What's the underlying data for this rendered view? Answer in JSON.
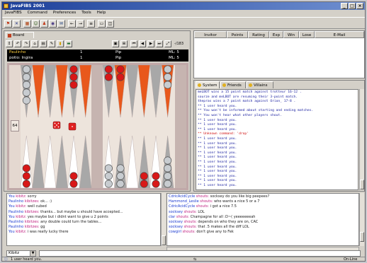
{
  "window": {
    "title": "JavaFIBS 2001"
  },
  "menu": [
    "JavaFIBS",
    "Command",
    "Preferences",
    "Tools",
    "Help"
  ],
  "board_panel": {
    "tab_label": "Board",
    "score": {
      "player1": {
        "name": "Paulinho",
        "value": "1",
        "pip_label": "Pip",
        "ml": "ML: 5"
      },
      "player2": {
        "name": "potio: Ingira",
        "value": "1",
        "pip_label": "Pip",
        "ml": "ML: 5"
      },
      "pip_count": "-/183"
    },
    "cube_value": "64",
    "colors": {
      "dark_point": "#a8a8a8",
      "light_point": "#ffffff",
      "accent_point": "#e8581c",
      "red_checker": "#d81818",
      "white_checker": "#c8ccd0"
    }
  },
  "player_table": {
    "columns": [
      "Invitor",
      "Points",
      "Rating",
      "Exp",
      "Win",
      "Lose",
      "E-Mail"
    ]
  },
  "message_panel": {
    "tabs": [
      "System",
      "Friends",
      "Villains"
    ],
    "lines": [
      {
        "text": "meLBOT wins a 15 point match against trotteur 16-12 .",
        "color": "blue"
      },
      {
        "text": "sourze and meLBOT are resuming their 3-point match.",
        "color": "blue"
      },
      {
        "text": "thepras wins a 7 point match against Orion_ 17-8 .",
        "color": "blue"
      },
      {
        "text": "** 1 user heard you.",
        "color": "blue"
      },
      {
        "text": "** You won't be informed about starting and ending matches.",
        "color": "blue"
      },
      {
        "text": "** You won't hear what other players shout.",
        "color": "blue"
      },
      {
        "text": "** 1 user heard you.",
        "color": "blue"
      },
      {
        "text": "** 1 user heard you.",
        "color": "blue"
      },
      {
        "text": "** 1 user heard you.",
        "color": "blue"
      },
      {
        "text": "** Unknown command: 'drop'",
        "color": "red"
      },
      {
        "text": "** 1 user heard you.",
        "color": "blue"
      },
      {
        "text": "** 1 user heard you.",
        "color": "blue"
      },
      {
        "text": "** 1 user heard you.",
        "color": "blue"
      },
      {
        "text": "** 1 user heard you.",
        "color": "blue"
      },
      {
        "text": "** 1 user heard you.",
        "color": "blue"
      },
      {
        "text": "** 1 user heard you.",
        "color": "blue"
      },
      {
        "text": "** 1 user heard you.",
        "color": "blue"
      },
      {
        "text": "** 1 user heard you.",
        "color": "blue"
      },
      {
        "text": "** 1 user heard you.",
        "color": "blue"
      },
      {
        "text": "** 1 user heard you.",
        "color": "blue"
      },
      {
        "text": "** 1 user heard you.",
        "color": "blue"
      }
    ]
  },
  "chat_left": [
    {
      "name": "You",
      "action": "kibitz:",
      "text": "sorry"
    },
    {
      "name": "Paulinho",
      "action": "kibitzes:",
      "text": "ok... :)"
    },
    {
      "name": "You",
      "action": "kibitz:",
      "text": "well cubed"
    },
    {
      "name": "Paulinho",
      "action": "kibitzes:",
      "text": "thanks... but maybe u should have accepted..."
    },
    {
      "name": "You",
      "action": "kibitz:",
      "text": "yes maybe but i didnt want to give u 2 points"
    },
    {
      "name": "Paulinho",
      "action": "kibitzes:",
      "text": "any double could turn the tables..."
    },
    {
      "name": "Paulinho",
      "action": "kibitzes:",
      "text": "gg"
    },
    {
      "name": "You",
      "action": "kibitz:",
      "text": "i was really lucky there"
    }
  ],
  "chat_right": [
    {
      "name": "CdricAcidCycle",
      "action": "shouts:",
      "text": "socksey do you like big peepees?"
    },
    {
      "name": "Hammond_Leslie",
      "action": "shouts:",
      "text": "who wants a nice 5 or a 7"
    },
    {
      "name": "CdricAcidCycle",
      "action": "shouts:",
      "text": "i got a nice 7.5"
    },
    {
      "name": "socksey",
      "action": "shouts:",
      "text": "LOL"
    },
    {
      "name": "clar",
      "action": "shouts:",
      "text": "Champagne for all    :D~(   yeeeeeeeah"
    },
    {
      "name": "socksey",
      "action": "shouts:",
      "text": "depends on who they are on, CAC"
    },
    {
      "name": "socksey",
      "action": "shouts:",
      "text": "that .5 makes all the diff  LOL"
    },
    {
      "name": "cowgirl",
      "action": "shouts:",
      "text": "don't give any to Fek"
    }
  ],
  "input": {
    "command_type": "Kibitz",
    "value": ""
  },
  "status": {
    "message": "1 user heard you.",
    "state": "On-Line"
  }
}
